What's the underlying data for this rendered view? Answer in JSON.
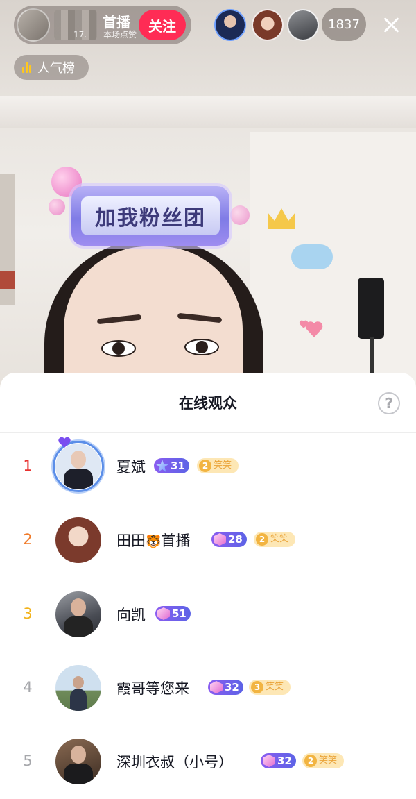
{
  "host": {
    "name": "首播",
    "id_prefix": "17.",
    "likes_label": "本场点赞",
    "follow_label": "关注"
  },
  "viewer_count": "1837",
  "rank_label": "人气榜",
  "stream": {
    "sticker_text": "加我粉丝团"
  },
  "sheet": {
    "title": "在线观众",
    "help_glyph": "?"
  },
  "colors": {
    "follow": "#ff2c55",
    "rank_1": "#e8312f",
    "rank_2": "#f07b2a",
    "rank_3": "#f2b31c",
    "rank_other": "#a6a7ab",
    "fan_badge_bg": "#fde7b5",
    "fan_badge_text": "#e9a237"
  },
  "audience": [
    {
      "rank": "1",
      "name": "夏斌",
      "level": "31",
      "level_icon": "star-icon",
      "fan_level": "2",
      "fan_label": "笑笑"
    },
    {
      "rank": "2",
      "name_a": "田田",
      "name_emoji": "🐯",
      "name_b": "首播",
      "level": "28",
      "level_icon": "gem-icon",
      "fan_level": "2",
      "fan_label": "笑笑"
    },
    {
      "rank": "3",
      "name": "向凯",
      "level": "51",
      "level_icon": "gem-icon"
    },
    {
      "rank": "4",
      "name": "霞哥等您来",
      "level": "32",
      "level_icon": "gem-icon",
      "fan_level": "3",
      "fan_label": "笑笑"
    },
    {
      "rank": "5",
      "name": "深圳衣叔（小号）",
      "level": "32",
      "level_icon": "gem-icon",
      "fan_level": "2",
      "fan_label": "笑笑"
    }
  ]
}
